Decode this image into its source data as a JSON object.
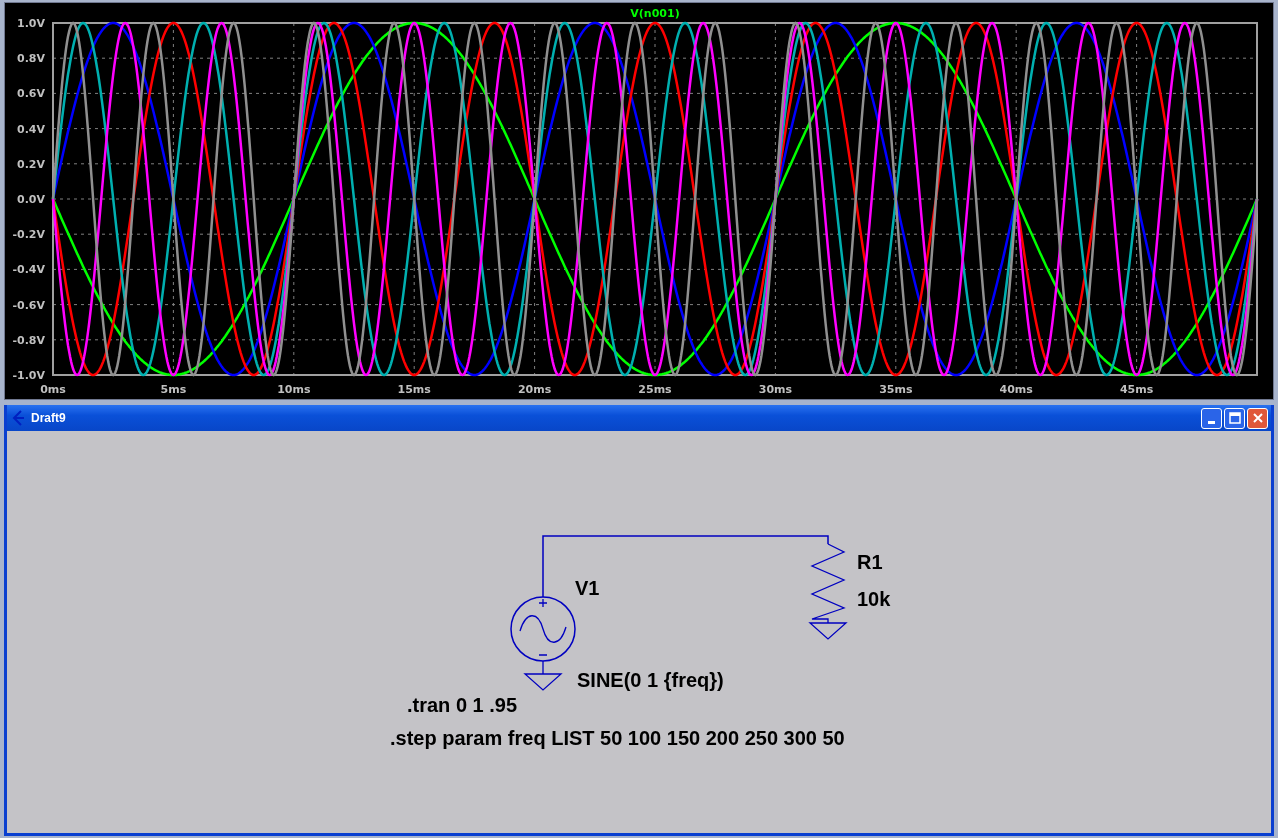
{
  "plot": {
    "title": "V(n001)",
    "y_ticks": [
      "1.0V",
      "0.8V",
      "0.6V",
      "0.4V",
      "0.2V",
      "0.0V",
      "-0.2V",
      "-0.4V",
      "-0.6V",
      "-0.8V",
      "-1.0V"
    ],
    "x_ticks": [
      "0ms",
      "5ms",
      "10ms",
      "15ms",
      "20ms",
      "25ms",
      "30ms",
      "35ms",
      "40ms",
      "45ms"
    ],
    "traces": [
      {
        "color": "#00ff00"
      },
      {
        "color": "#0000ff"
      },
      {
        "color": "#ff0000"
      },
      {
        "color": "#00b0b0"
      },
      {
        "color": "#ff00ff"
      },
      {
        "color": "#909090"
      }
    ]
  },
  "window": {
    "title": "Draft9"
  },
  "schematic": {
    "source": {
      "name": "V1",
      "value": "SINE(0 1 {freq})"
    },
    "resistor": {
      "name": "R1",
      "value": "10k"
    },
    "directives": [
      ".tran 0 1 .95",
      ".step param freq LIST 50 100 150 200 250 300 50"
    ]
  }
}
